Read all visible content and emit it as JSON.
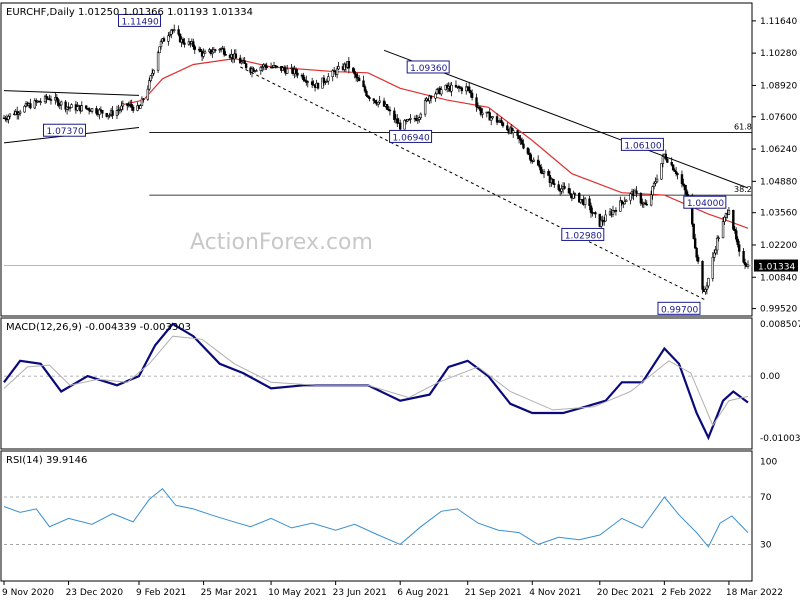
{
  "chart_data": [
    {
      "type": "candlestick",
      "panel": "price",
      "header": "EURCHF,Daily  1.01250 1.01366 1.01193 1.01334",
      "symbol": "EURCHF",
      "timeframe": "Daily",
      "ohlc_last": {
        "open": 1.0125,
        "high": 1.01366,
        "low": 1.01193,
        "close": 1.01334
      },
      "watermark": "ActionForex.com",
      "ylim": [
        0.9925,
        1.1235
      ],
      "y_ticks": [
        "1.11640",
        "1.10280",
        "1.08920",
        "1.07600",
        "1.06240",
        "1.04880",
        "1.03560",
        "1.02200",
        "1.00840",
        "0.99520"
      ],
      "current_price_label": "1.01334",
      "ma_color": "#e03030",
      "x_ticks": [
        "9 Nov 2020",
        "23 Dec 2020",
        "9 Feb 2021",
        "25 Mar 2021",
        "10 May 2021",
        "23 Jun 2021",
        "6 Aug 2021",
        "21 Sep 2021",
        "4 Nov 2021",
        "20 Dec 2021",
        "2 Feb 2022",
        "18 Mar 2022"
      ],
      "x_range": [
        "2020-11-09",
        "2022-03-31"
      ],
      "close_path": [
        [
          "2020-11-09",
          1.0755
        ],
        [
          "2020-11-25",
          1.0805
        ],
        [
          "2020-12-10",
          1.084
        ],
        [
          "2020-12-23",
          1.08
        ],
        [
          "2021-01-06",
          1.0795
        ],
        [
          "2021-01-20",
          1.077
        ],
        [
          "2021-02-01",
          1.081
        ],
        [
          "2021-02-09",
          1.079
        ],
        [
          "2021-02-16",
          1.09
        ],
        [
          "2021-02-23",
          1.106
        ],
        [
          "2021-03-03",
          1.113
        ],
        [
          "2021-03-10",
          1.108
        ],
        [
          "2021-03-18",
          1.106
        ],
        [
          "2021-03-25",
          1.102
        ],
        [
          "2021-04-05",
          1.105
        ],
        [
          "2021-04-15",
          1.101
        ],
        [
          "2021-04-26",
          1.096
        ],
        [
          "2021-05-06",
          1.0975
        ],
        [
          "2021-05-18",
          1.096
        ],
        [
          "2021-05-28",
          1.0945
        ],
        [
          "2021-06-10",
          1.089
        ],
        [
          "2021-06-23",
          1.095
        ],
        [
          "2021-07-01",
          1.098
        ],
        [
          "2021-07-15",
          1.085
        ],
        [
          "2021-07-27",
          1.08
        ],
        [
          "2021-08-06",
          1.072
        ],
        [
          "2021-08-18",
          1.076
        ],
        [
          "2021-08-26",
          1.085
        ],
        [
          "2021-09-06",
          1.088
        ],
        [
          "2021-09-21",
          1.088
        ],
        [
          "2021-09-30",
          1.078
        ],
        [
          "2021-10-15",
          1.073
        ],
        [
          "2021-10-28",
          1.065
        ],
        [
          "2021-11-04",
          1.058
        ],
        [
          "2021-11-18",
          1.048
        ],
        [
          "2021-12-01",
          1.043
        ],
        [
          "2021-12-10",
          1.04
        ],
        [
          "2021-12-20",
          1.031
        ],
        [
          "2022-01-04",
          1.04
        ],
        [
          "2022-01-12",
          1.044
        ],
        [
          "2022-01-21",
          1.038
        ],
        [
          "2022-02-02",
          1.06
        ],
        [
          "2022-02-10",
          1.053
        ],
        [
          "2022-02-18",
          1.042
        ],
        [
          "2022-02-24",
          1.018
        ],
        [
          "2022-03-01",
          1.001
        ],
        [
          "2022-03-04",
          1.008
        ],
        [
          "2022-03-10",
          1.024
        ],
        [
          "2022-03-18",
          1.038
        ],
        [
          "2022-03-25",
          1.018
        ],
        [
          "2022-03-31",
          1.0133
        ]
      ],
      "moving_average": [
        [
          "2021-01-28",
          1.081
        ],
        [
          "2021-02-12",
          1.083
        ],
        [
          "2021-02-25",
          1.092
        ],
        [
          "2021-03-18",
          1.098
        ],
        [
          "2021-04-15",
          1.1005
        ],
        [
          "2021-05-10",
          1.097
        ],
        [
          "2021-06-23",
          1.095
        ],
        [
          "2021-07-15",
          1.0945
        ],
        [
          "2021-08-06",
          1.088
        ],
        [
          "2021-09-07",
          1.083
        ],
        [
          "2021-10-05",
          1.08
        ],
        [
          "2021-11-04",
          1.066
        ],
        [
          "2021-12-01",
          1.052
        ],
        [
          "2022-01-04",
          1.044
        ],
        [
          "2022-02-02",
          1.043
        ],
        [
          "2022-03-04",
          1.035
        ],
        [
          "2022-03-18",
          1.032
        ],
        [
          "2022-03-31",
          1.029
        ]
      ],
      "annotations": [
        {
          "label": "1.11490",
          "date": "2021-02-25",
          "value": 1.1149
        },
        {
          "label": "1.07370",
          "date": "2020-12-10",
          "value": 1.0737
        },
        {
          "label": "1.09360",
          "date": "2021-09-07",
          "value": 1.0936
        },
        {
          "label": "1.06940",
          "date": "2021-08-26",
          "value": 1.0694
        },
        {
          "label": "1.06100",
          "date": "2022-01-31",
          "value": 1.061
        },
        {
          "label": "1.04000",
          "date": "2022-02-18",
          "value": 1.04
        },
        {
          "label": "1.02980",
          "date": "2021-12-20",
          "value": 1.0298
        },
        {
          "label": "0.99700",
          "date": "2022-03-01",
          "value": 0.997
        }
      ],
      "fib_levels": [
        {
          "label": "61.8",
          "value": 1.0694,
          "from": "2021-02-16"
        },
        {
          "label": "38.2",
          "value": 1.043,
          "from": "2021-02-16"
        }
      ],
      "trendlines": [
        {
          "style": "solid",
          "from": [
            "2021-07-26",
            1.104
          ],
          "to": [
            "2022-03-31",
            1.046
          ]
        },
        {
          "style": "dashed",
          "from": [
            "2021-04-19",
            1.097
          ],
          "to": [
            "2022-03-03",
            0.9985
          ]
        },
        {
          "style": "solid",
          "from": [
            "2020-11-09",
            1.087
          ],
          "to": [
            "2021-02-09",
            1.085
          ]
        },
        {
          "style": "solid",
          "from": [
            "2020-11-09",
            1.065
          ],
          "to": [
            "2021-02-09",
            1.0715
          ]
        }
      ]
    },
    {
      "type": "line",
      "panel": "macd",
      "header": "MACD(12,26,9) -0.004339 -0.003303",
      "ylim": [
        -0.0117,
        0.0093
      ],
      "y_ticks": [
        "0.008507",
        "0.00",
        "-0.010034"
      ],
      "series": [
        {
          "role": "macd",
          "color": "#0a0a7a",
          "points": [
            [
              "2020-11-09",
              -0.001
            ],
            [
              "2020-11-20",
              0.0025
            ],
            [
              "2020-12-04",
              0.002
            ],
            [
              "2020-12-18",
              -0.0025
            ],
            [
              "2021-01-05",
              0.0
            ],
            [
              "2021-01-25",
              -0.0015
            ],
            [
              "2021-02-09",
              0.0
            ],
            [
              "2021-02-20",
              0.005
            ],
            [
              "2021-03-04",
              0.0085
            ],
            [
              "2021-03-18",
              0.0065
            ],
            [
              "2021-04-05",
              0.002
            ],
            [
              "2021-04-21",
              0.0005
            ],
            [
              "2021-05-10",
              -0.002
            ],
            [
              "2021-06-01",
              -0.0015
            ],
            [
              "2021-06-23",
              -0.0015
            ],
            [
              "2021-07-15",
              -0.0015
            ],
            [
              "2021-08-06",
              -0.004
            ],
            [
              "2021-08-26",
              -0.003
            ],
            [
              "2021-09-08",
              0.0015
            ],
            [
              "2021-09-21",
              0.0025
            ],
            [
              "2021-10-05",
              0.0
            ],
            [
              "2021-10-20",
              -0.0045
            ],
            [
              "2021-11-04",
              -0.006
            ],
            [
              "2021-11-25",
              -0.006
            ],
            [
              "2021-12-10",
              -0.005
            ],
            [
              "2021-12-24",
              -0.004
            ],
            [
              "2022-01-04",
              -0.001
            ],
            [
              "2022-01-18",
              -0.001
            ],
            [
              "2022-02-02",
              0.0045
            ],
            [
              "2022-02-12",
              0.002
            ],
            [
              "2022-02-24",
              -0.006
            ],
            [
              "2022-03-04",
              -0.01
            ],
            [
              "2022-03-14",
              -0.004
            ],
            [
              "2022-03-21",
              -0.0025
            ],
            [
              "2022-03-31",
              -0.0043
            ]
          ]
        },
        {
          "role": "signal",
          "color": "#b0b0b0",
          "points": [
            [
              "2020-11-09",
              -0.002
            ],
            [
              "2020-11-25",
              0.0015
            ],
            [
              "2020-12-10",
              0.0018
            ],
            [
              "2020-12-24",
              -0.0015
            ],
            [
              "2021-01-12",
              -0.0005
            ],
            [
              "2021-02-01",
              -0.001
            ],
            [
              "2021-02-16",
              0.002
            ],
            [
              "2021-03-04",
              0.0065
            ],
            [
              "2021-03-24",
              0.006
            ],
            [
              "2021-04-15",
              0.002
            ],
            [
              "2021-05-10",
              -0.001
            ],
            [
              "2021-06-10",
              -0.0015
            ],
            [
              "2021-07-15",
              -0.0015
            ],
            [
              "2021-08-12",
              -0.0035
            ],
            [
              "2021-09-01",
              -0.001
            ],
            [
              "2021-09-28",
              0.0015
            ],
            [
              "2021-10-20",
              -0.0025
            ],
            [
              "2021-11-18",
              -0.0055
            ],
            [
              "2021-12-16",
              -0.005
            ],
            [
              "2022-01-10",
              -0.0025
            ],
            [
              "2022-02-05",
              0.0025
            ],
            [
              "2022-02-20",
              0.0005
            ],
            [
              "2022-03-07",
              -0.008
            ],
            [
              "2022-03-18",
              -0.004
            ],
            [
              "2022-03-31",
              -0.0033
            ]
          ]
        }
      ]
    },
    {
      "type": "line",
      "panel": "rsi",
      "header": "RSI(14) 39.9146",
      "ylim": [
        0,
        108
      ],
      "y_ticks": [
        "100",
        "70",
        "30"
      ],
      "levels": [
        70,
        30
      ],
      "series": [
        {
          "role": "rsi",
          "color": "#3a8fd0",
          "points": [
            [
              "2020-11-09",
              62
            ],
            [
              "2020-11-20",
              57
            ],
            [
              "2020-12-01",
              60
            ],
            [
              "2020-12-10",
              45
            ],
            [
              "2020-12-23",
              52
            ],
            [
              "2021-01-08",
              47
            ],
            [
              "2021-01-22",
              56
            ],
            [
              "2021-02-05",
              49
            ],
            [
              "2021-02-16",
              68
            ],
            [
              "2021-02-25",
              77
            ],
            [
              "2021-03-06",
              63
            ],
            [
              "2021-03-18",
              60
            ],
            [
              "2021-03-30",
              55
            ],
            [
              "2021-04-12",
              50
            ],
            [
              "2021-04-26",
              45
            ],
            [
              "2021-05-10",
              52
            ],
            [
              "2021-05-24",
              44
            ],
            [
              "2021-06-07",
              48
            ],
            [
              "2021-06-23",
              42
            ],
            [
              "2021-07-06",
              47
            ],
            [
              "2021-07-22",
              38
            ],
            [
              "2021-08-06",
              30
            ],
            [
              "2021-08-20",
              45
            ],
            [
              "2021-09-03",
              58
            ],
            [
              "2021-09-14",
              60
            ],
            [
              "2021-09-28",
              48
            ],
            [
              "2021-10-12",
              42
            ],
            [
              "2021-10-26",
              40
            ],
            [
              "2021-11-08",
              30
            ],
            [
              "2021-11-22",
              36
            ],
            [
              "2021-12-06",
              34
            ],
            [
              "2021-12-20",
              38
            ],
            [
              "2022-01-04",
              52
            ],
            [
              "2022-01-18",
              44
            ],
            [
              "2022-02-02",
              70
            ],
            [
              "2022-02-12",
              55
            ],
            [
              "2022-02-24",
              40
            ],
            [
              "2022-03-04",
              28
            ],
            [
              "2022-03-12",
              48
            ],
            [
              "2022-03-20",
              54
            ],
            [
              "2022-03-31",
              40
            ]
          ]
        }
      ]
    }
  ]
}
